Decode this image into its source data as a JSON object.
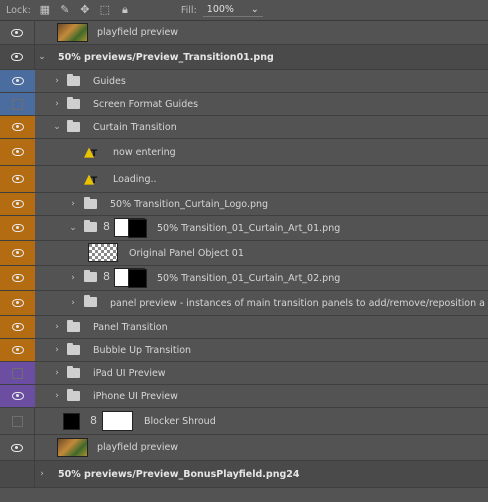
{
  "toolbar": {
    "lock_label": "Lock:",
    "fill_label": "Fill:",
    "fill_value": "100%",
    "icons": [
      "checkerboard-lock-icon",
      "brush-lock-icon",
      "move-lock-icon",
      "artboard-lock-icon",
      "padlock-icon"
    ]
  },
  "layers": {
    "playfield_preview_top": "playfield preview",
    "group_preview_transition": "50% previews/Preview_Transition01.png",
    "guides": "Guides",
    "screen_format_guides": "Screen Format Guides",
    "curtain_transition": "Curtain Transition",
    "now_entering": "now entering",
    "loading": "Loading..",
    "curtain_logo": "50% Transition_Curtain_Logo.png",
    "curtain_art_01": "50% Transition_01_Curtain_Art_01.png",
    "original_panel": "Original Panel Object 01",
    "curtain_art_02": "50% Transition_01_Curtain_Art_02.png",
    "panel_preview": "panel preview - instances of main transition panels to add/remove/reposition as ne...",
    "panel_transition": "Panel Transition",
    "bubble_up": "Bubble Up Transition",
    "ipad_preview": "iPad UI Preview",
    "iphone_preview": "iPhone UI Preview",
    "blocker_shroud": "Blocker Shroud",
    "playfield_preview_bottom": "playfield preview",
    "group_bonus_playfield": "50% previews/Preview_BonusPlayfield.png24"
  },
  "colors": {
    "blue_tag": "#4a6c9e",
    "orange_tag": "#b46c12",
    "violet_tag": "#6b4ea2",
    "panel_bg": "#535353"
  }
}
